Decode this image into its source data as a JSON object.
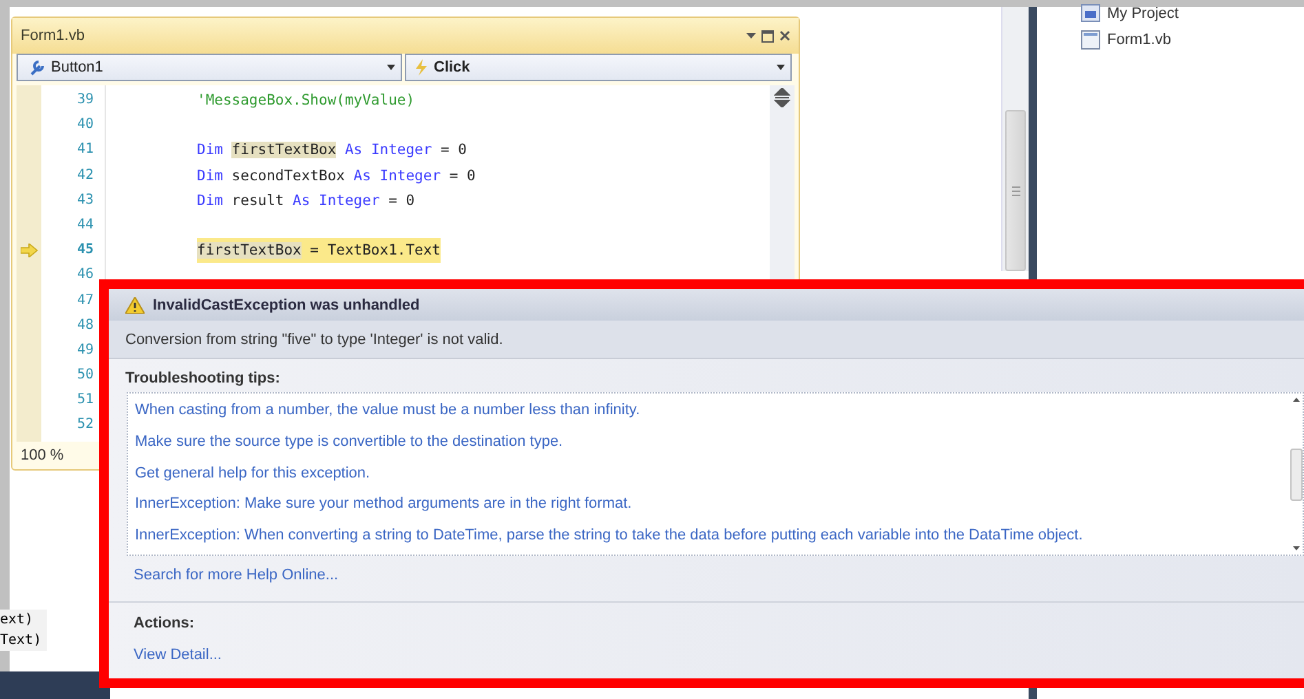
{
  "editor": {
    "title": "Form1.vb",
    "object_dropdown": "Button1",
    "event_dropdown": "Click",
    "zoom": "100 %",
    "lines": [
      {
        "number": "39",
        "tokens": [
          {
            "text": "'MessageBox.Show(myValue)",
            "kind": "comment"
          }
        ],
        "current": false
      },
      {
        "number": "40",
        "current": false
      },
      {
        "number": "41",
        "tokens": [
          {
            "text": "Dim ",
            "kind": "keyword"
          },
          {
            "text": "firstTextBox",
            "kind": "ref"
          },
          {
            "text": " As Integer",
            "kind": "keyword"
          },
          {
            "text": " = 0",
            "kind": "text"
          }
        ],
        "current": false
      },
      {
        "number": "42",
        "tokens": [
          {
            "text": "Dim ",
            "kind": "keyword"
          },
          {
            "text": "secondTextBox",
            "kind": "text"
          },
          {
            "text": " As Integer",
            "kind": "keyword"
          },
          {
            "text": " = 0",
            "kind": "text"
          }
        ],
        "current": false
      },
      {
        "number": "43",
        "tokens": [
          {
            "text": "Dim ",
            "kind": "keyword"
          },
          {
            "text": "result",
            "kind": "text"
          },
          {
            "text": " As Integer",
            "kind": "keyword"
          },
          {
            "text": " = 0",
            "kind": "text"
          }
        ],
        "current": false
      },
      {
        "number": "44",
        "current": false
      },
      {
        "number": "45",
        "tokens": [
          {
            "text": "firstTextBox",
            "kind": "ref"
          },
          {
            "text": " = TextBox1.Text",
            "kind": "text"
          }
        ],
        "current": true
      },
      {
        "number": "46",
        "current": false
      },
      {
        "number": "47",
        "current": false
      },
      {
        "number": "48",
        "current": false
      },
      {
        "number": "49",
        "current": false
      },
      {
        "number": "50",
        "current": false
      },
      {
        "number": "51",
        "current": false
      },
      {
        "number": "52",
        "current": false
      }
    ]
  },
  "background_code": [
    "ext)",
    "Text)"
  ],
  "solution_explorer": {
    "items": [
      {
        "label": "My Project",
        "kind": "project"
      },
      {
        "label": "Form1.vb",
        "kind": "file"
      }
    ]
  },
  "exception": {
    "title": "InvalidCastException was unhandled",
    "message": "Conversion from string \"five\" to type 'Integer' is not valid.",
    "tips_heading": "Troubleshooting tips:",
    "tips": [
      "When casting from a number, the value must be a number less than infinity.",
      "Make sure the source type is convertible to the destination type.",
      "Get general help for this exception.",
      "InnerException: Make sure your method arguments are in the right format.",
      "InnerException: When converting a string to DateTime, parse the string to take the data before putting each variable into the DataTime object."
    ],
    "search_link": "Search for more Help Online...",
    "actions_heading": "Actions:",
    "actions": [
      "View Detail..."
    ]
  }
}
